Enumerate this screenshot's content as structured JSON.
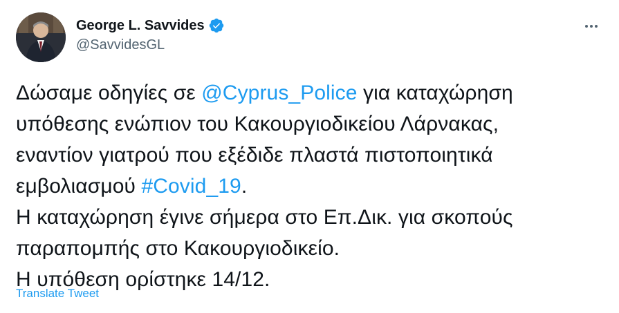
{
  "author": {
    "display_name": "George L. Savvides",
    "handle": "@SavvidesGL",
    "verified_icon": "verified-badge-icon",
    "avatar": "profile-photo"
  },
  "menu": {
    "more_icon": "more-horizontal-icon"
  },
  "tweet": {
    "line1_pre": "Δώσαμε οδηγίες σε ",
    "mention": "@Cyprus_Police",
    "line1_post": " για καταχώρηση",
    "line2": "υπόθεσης ενώπιον του Κακουργιοδικείου Λάρνακας,",
    "line3": "εναντίον γιατρού που εξέδιδε πλαστά πιστοποιητικά",
    "line4_pre": "εμβολιασμού ",
    "hashtag": "#Covid_19",
    "line4_post": ".",
    "line5": "Η καταχώρηση έγινε σήμερα στο Επ.Δικ. για σκοπούς",
    "line6": "παραπομπής στο Κακουργιοδικείο.",
    "line7": "Η υπόθεση ορίστηκε 14/12."
  },
  "translate_label": "Translate Tweet",
  "colors": {
    "link": "#1d9bf0",
    "text": "#0f1419",
    "secondary": "#536471"
  }
}
